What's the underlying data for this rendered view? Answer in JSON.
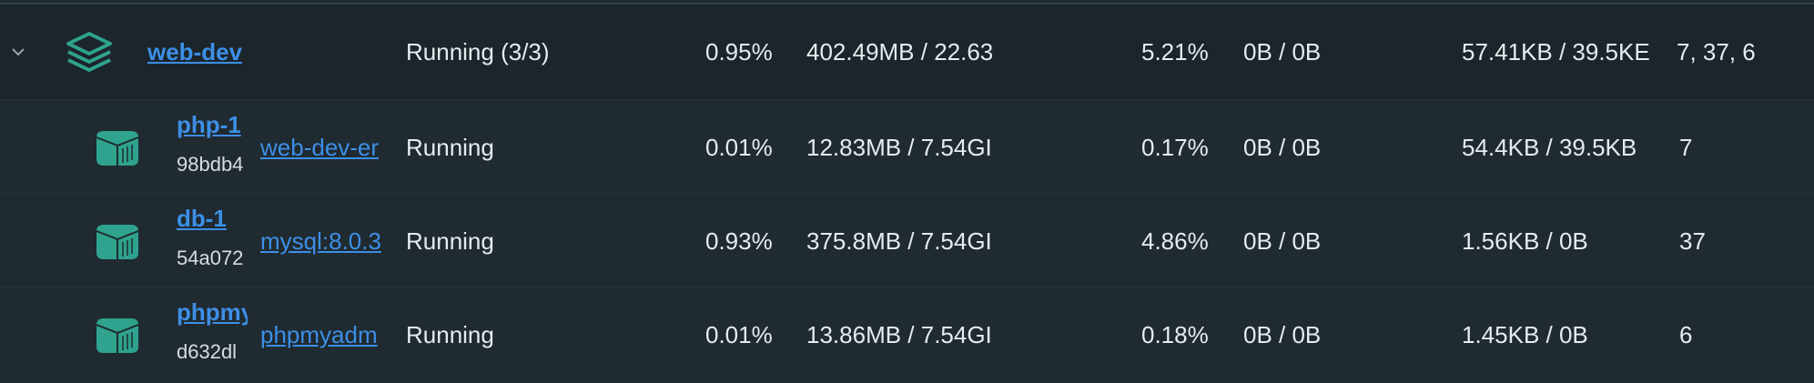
{
  "group": {
    "name": "web-dev",
    "status": "Running (3/3)",
    "cpu": "0.95%",
    "memory": "402.49MB / 22.63",
    "memory_pct": "5.21%",
    "disk_io": "0B / 0B",
    "network_io": "57.41KB / 39.5KE",
    "pids": "7, 37, 6"
  },
  "containers": [
    {
      "name": "php-1",
      "id": "98bdb4",
      "image": "web-dev-er",
      "status": "Running",
      "cpu": "0.01%",
      "memory": "12.83MB / 7.54GI",
      "memory_pct": "0.17%",
      "disk_io": "0B / 0B",
      "network_io": "54.4KB / 39.5KB",
      "pids": "7"
    },
    {
      "name": "db-1",
      "id": "54a072",
      "image": "mysql:8.0.3",
      "status": "Running",
      "cpu": "0.93%",
      "memory": "375.8MB / 7.54GI",
      "memory_pct": "4.86%",
      "disk_io": "0B / 0B",
      "network_io": "1.56KB / 0B",
      "pids": "37"
    },
    {
      "name": "phpmy",
      "id": "d632dl",
      "image": "phpmyadm",
      "status": "Running",
      "cpu": "0.01%",
      "memory": "13.86MB / 7.54GI",
      "memory_pct": "0.18%",
      "disk_io": "0B / 0B",
      "network_io": "1.45KB / 0B",
      "pids": "6"
    }
  ],
  "icons": {
    "expand": "chevron-down-icon",
    "group": "stack-layers-icon",
    "container": "container-cube-icon"
  },
  "colors": {
    "background": "#1f2a31",
    "link": "#3d8fe6",
    "icon_teal": "#2fa38d"
  }
}
